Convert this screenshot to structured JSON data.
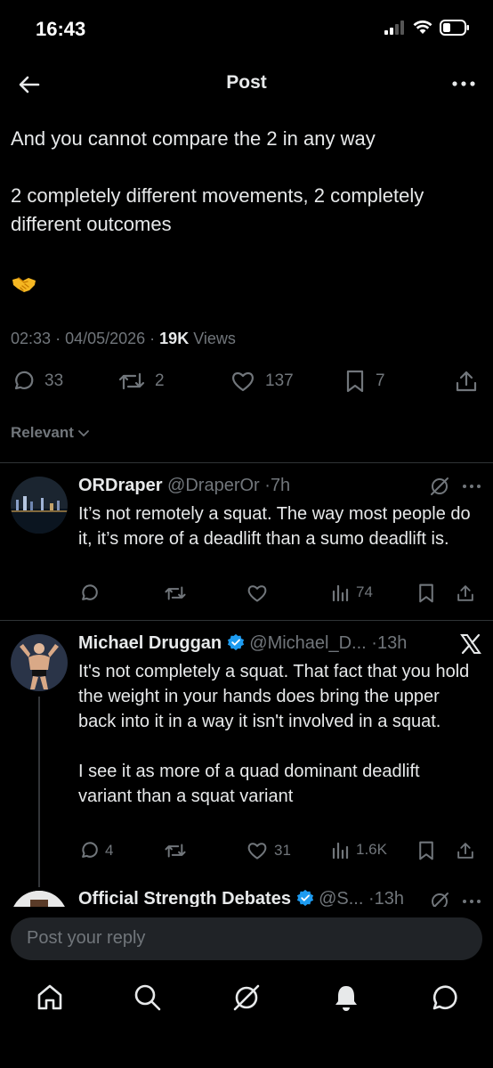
{
  "status_bar": {
    "time": "16:43"
  },
  "header": {
    "title": "Post"
  },
  "post": {
    "paragraphs": [
      "And you cannot compare the 2 in any way",
      "2 completely different movements, 2 completely different outcomes"
    ],
    "emoji": "handshake-emoji",
    "time": "02:33",
    "date": "04/05/2026",
    "views_count": "19K",
    "views_label": "Views",
    "replies": "33",
    "reposts": "2",
    "likes": "137",
    "bookmarks": "7"
  },
  "sort": {
    "label": "Relevant"
  },
  "replies": [
    {
      "name": "ORDraper",
      "handle": "@DraperOr",
      "time": "7h",
      "body": [
        "It’s not remotely a squat. The way most people do it, it’s more of a deadlift than a sumo deadlift is."
      ],
      "replies": "",
      "reposts": "",
      "likes": "",
      "views": "74"
    },
    {
      "name": "Michael Druggan",
      "handle": "@Michael_D...",
      "time": "13h",
      "verified": true,
      "body": [
        "It's not completely a squat. That fact that you hold the weight in your hands does bring the upper back into it in a way it isn't involved in a squat.",
        "I see it as more of a quad dominant deadlift variant than a squat variant"
      ],
      "replies": "4",
      "reposts": "",
      "likes": "31",
      "views": "1.6K"
    },
    {
      "name": "Official Strength Debates",
      "handle": "@S...",
      "time": "13h",
      "verified": true
    }
  ],
  "composer": {
    "placeholder": "Post your reply"
  },
  "colors": {
    "background": "#000000",
    "text": "#e7e9ea",
    "secondary": "#71767b",
    "verified": "#1d9bf0",
    "divider": "#2f3336"
  }
}
